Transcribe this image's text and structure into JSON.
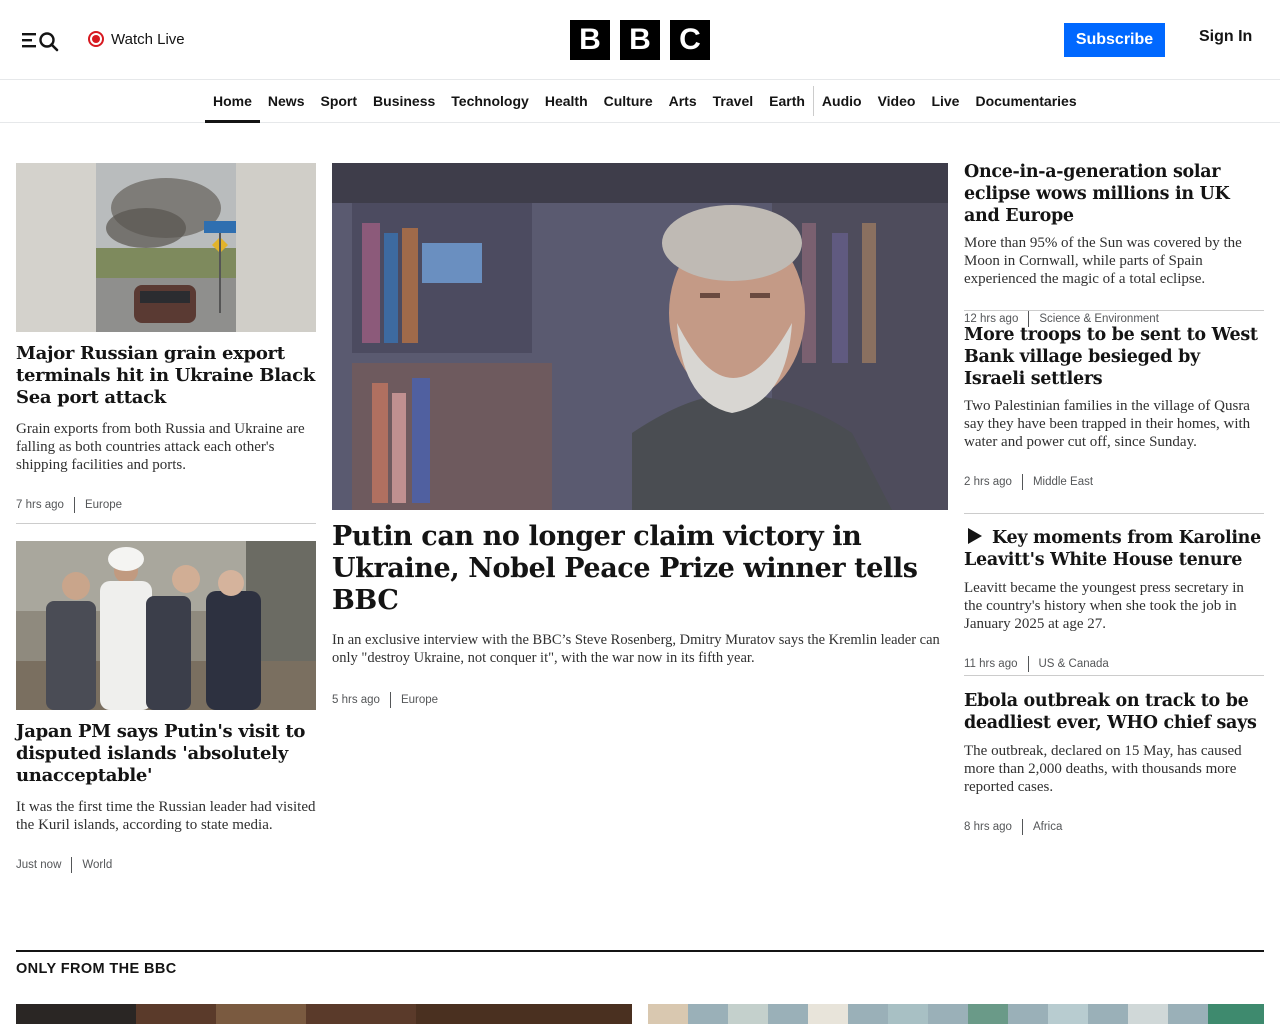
{
  "header": {
    "watch_live": "Watch Live",
    "logo_letters": [
      "B",
      "B",
      "C"
    ],
    "subscribe": "Subscribe",
    "sign_in": "Sign In"
  },
  "nav": {
    "items": [
      "Home",
      "News",
      "Sport",
      "Business",
      "Technology",
      "Health",
      "Culture",
      "Arts",
      "Travel",
      "Earth",
      "Audio",
      "Video",
      "Live",
      "Documentaries"
    ],
    "active": "Home"
  },
  "left": [
    {
      "headline": "Major Russian grain export terminals hit in Ukraine Black Sea port attack",
      "summary": "Grain exports from both Russia and Ukraine are falling as both countries attack each other's shipping facilities and ports.",
      "time": "7 hrs ago",
      "category": "Europe"
    },
    {
      "headline": "Japan PM says Putin's visit to disputed islands 'absolutely unacceptable'",
      "summary": "It was the first time the Russian leader had visited the Kuril islands, according to state media.",
      "time": "Just now",
      "category": "World"
    }
  ],
  "center": {
    "headline": "Putin can no longer claim victory in Ukraine, Nobel Peace Prize winner tells BBC",
    "summary": "In an exclusive interview with the BBC’s Steve Rosenberg, Dmitry Muratov says the Kremlin leader can only \"destroy Ukraine, not conquer it\", with the war now in its fifth year.",
    "time": "5 hrs ago",
    "category": "Europe"
  },
  "right": [
    {
      "headline": "Once-in-a-generation solar eclipse wows millions in UK and Europe",
      "summary": "More than 95% of the Sun was covered by the Moon in Cornwall, while parts of Spain experienced the magic of a total eclipse.",
      "time": "12 hrs ago",
      "category": "Science & Environment"
    },
    {
      "headline": "More troops to be sent to West Bank village besieged by Israeli settlers",
      "summary": "Two Palestinian families in the village of Qusra say they have been trapped in their homes, with water and power cut off, since Sunday.",
      "time": "2 hrs ago",
      "category": "Middle East"
    },
    {
      "headline": "Key moments from Karoline Leavitt's White House tenure",
      "summary": "Leavitt became the youngest press secretary in the country's history when she took the job in January 2025 at age 27.",
      "time": "11 hrs ago",
      "category": "US & Canada",
      "icon": "play-icon"
    },
    {
      "headline": "Ebola outbreak on track to be deadliest ever, WHO chief says",
      "summary": "The outbreak, declared on 15 May, has caused more than 2,000 deaths, with thousands more reported cases.",
      "time": "8 hrs ago",
      "category": "Africa"
    }
  ],
  "section": {
    "title": "ONLY FROM THE BBC"
  },
  "colors": {
    "subscribe_bg": "#0068ff",
    "live_red": "#d71920",
    "text": "#141414"
  }
}
